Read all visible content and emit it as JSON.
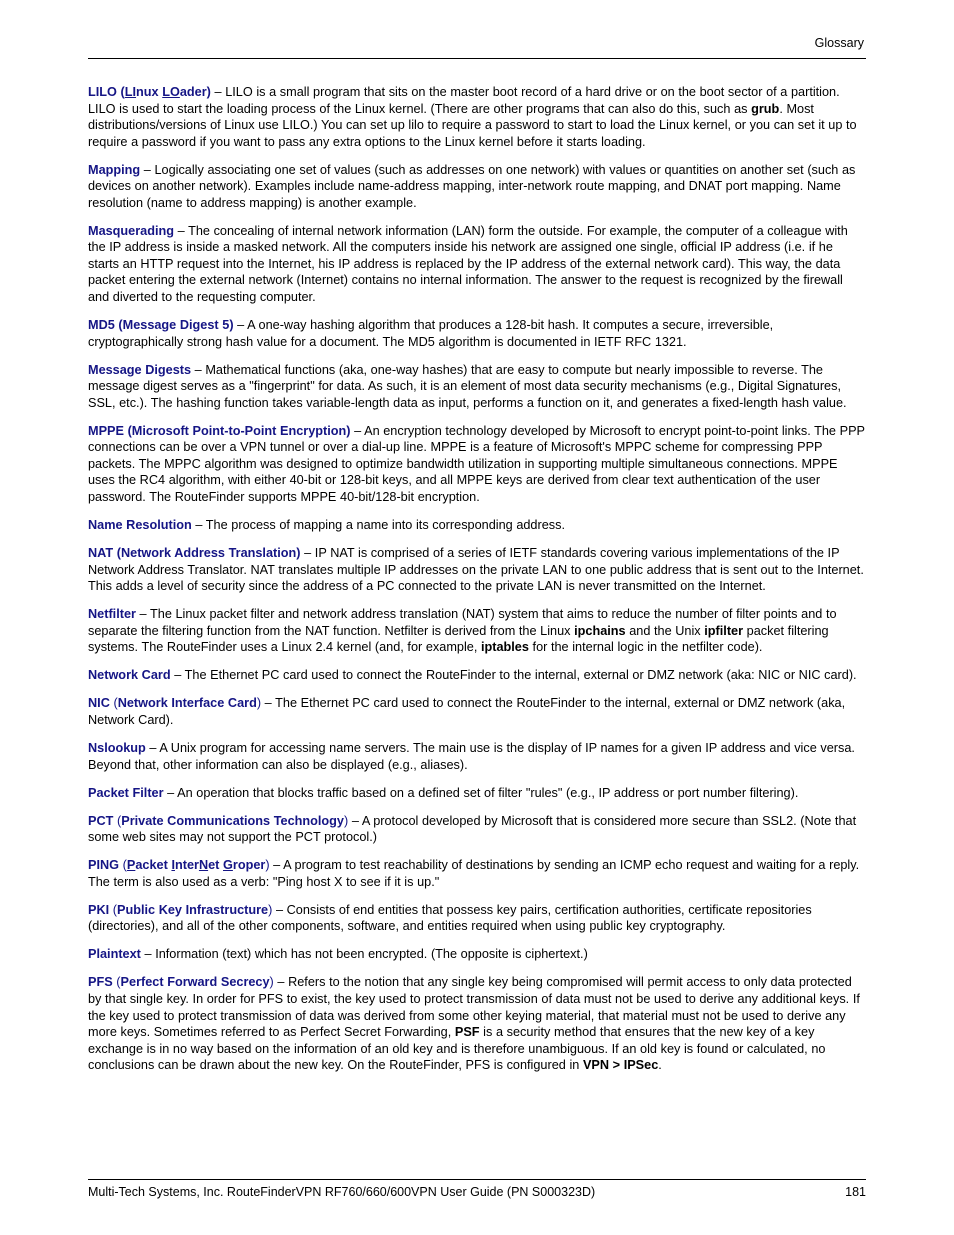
{
  "header": {
    "title": "Glossary"
  },
  "footer": {
    "source": "Multi-Tech Systems, Inc. RouteFinderVPN RF760/660/600VPN User Guide (PN S000323D)",
    "page_number": "181"
  },
  "colors": {
    "term": "#151585",
    "body": "#000000",
    "rule": "#000000",
    "background": "#ffffff"
  },
  "entries": [
    {
      "id": "lilo",
      "term": "LILO",
      "expansion_prefix": " (",
      "expansion_parts": [
        {
          "text": "LI",
          "underline": true
        },
        {
          "text": "nux ",
          "underline": false
        },
        {
          "text": "LO",
          "underline": true
        },
        {
          "text": "ader",
          "underline": false
        }
      ],
      "expansion_suffix": ")",
      "body": " – LILO is a small program that sits on the master boot record of a hard drive or on the boot sector of a partition. LILO is used to start the loading process of the Linux kernel.  (There are other programs that can also do this, such as ",
      "body_bold": "grub",
      "body_tail": ".  Most distributions/versions of Linux use LILO.)  You can set up lilo to require a password to start to load the Linux kernel, or you can set it up to require a password if you want to pass any extra options to the Linux kernel before it starts loading."
    },
    {
      "id": "mapping",
      "term": "Mapping",
      "body": " – Logically associating one set of values (such as addresses on one network) with values or quantities on another set (such as devices on another network).  Examples include name-address mapping, inter-network route mapping, and DNAT port mapping.  Name resolution (name to address mapping) is another example."
    },
    {
      "id": "masquerading",
      "term": "Masquerading",
      "body": " – The concealing of internal network information (LAN) form the outside. For example, the computer of a colleague with the IP address is inside a masked network. All the computers inside his network are assigned one single, official IP address (i.e. if he starts an HTTP request into the Internet, his IP address is replaced by the IP address of the external network card). This way, the data packet entering the external network (Internet) contains no internal information. The answer to the request is recognized by the firewall and diverted to the requesting computer."
    },
    {
      "id": "md5",
      "term": "MD5 (Message Digest 5)",
      "body": " – A one-way hashing algorithm that produces a 128-bit hash. It computes a secure, irreversible, cryptographically strong hash value for a document. The MD5 algorithm is documented in IETF RFC 1321."
    },
    {
      "id": "message-digests",
      "term": "Message Digests",
      "body": " – Mathematical functions (aka, one-way hashes) that are easy to compute but nearly impossible to reverse. The message digest serves as a \"fingerprint\" for data. As such, it is an element of most data security mechanisms (e.g., Digital Signatures, SSL, etc.). The hashing function takes variable-length data as input, performs a function on it, and generates a fixed-length hash value."
    },
    {
      "id": "mppe",
      "term": "MPPE (Microsoft Point-to-Point Encryption)",
      "body": " – An encryption technology developed by Microsoft to encrypt point-to-point links.  The PPP connections can be over a VPN tunnel or over a dial-up line. MPPE is a feature of Microsoft's MPPC scheme for compressing PPP packets.  The MPPC algorithm was designed to optimize bandwidth utilization in supporting multiple simultaneous connections.  MPPE uses the RC4 algorithm, with either 40-bit or 128-bit keys, and all MPPE keys are derived from clear text authentication of the user password.  The RouteFinder supports MPPE 40-bit/128-bit encryption."
    },
    {
      "id": "name-resolution",
      "term": "Name Resolution",
      "body": " – The process of mapping a name into its corresponding address."
    },
    {
      "id": "nat",
      "term": "NAT (Network Address Translation)",
      "body": " – IP NAT is comprised of a series of IETF standards covering various implementations of the IP Network Address Translator.  NAT translates multiple IP addresses on the private LAN to one public address that is sent out to the Internet. This adds a level of security since the address of a PC connected to the private LAN is never transmitted on the Internet."
    },
    {
      "id": "netfilter",
      "term": "Netfilter",
      "body": " – The Linux packet filter and network address translation (NAT) system that aims to reduce the number of filter points and to separate the filtering function from the NAT function. Netfilter is derived from the Linux ",
      "body_bold": "ipchains",
      "body_mid": " and the Unix ",
      "body_bold2": "ipfilter",
      "body_mid2": " packet filtering systems. The RouteFinder uses a Linux 2.4 kernel (and, for example, ",
      "body_bold3": "iptables",
      "body_tail": " for the internal logic in the netfilter code)."
    },
    {
      "id": "network-card",
      "term": "Network Card",
      "body": " – The Ethernet PC card used to connect the RouteFinder to the internal, external or DMZ network (aka: NIC or NIC card)."
    },
    {
      "id": "nic",
      "term": "NIC",
      "paren_open": " (",
      "term2": "Network Interface Card",
      "paren_close": ")",
      "body": " – The Ethernet PC card used to connect the RouteFinder to the internal, external or DMZ network (aka, Network Card)."
    },
    {
      "id": "nslookup",
      "term": "Nslookup",
      "body": " – A Unix program for accessing name servers. The main use is the display of IP names for a given IP address and vice versa. Beyond that, other information can also be displayed (e.g., aliases)."
    },
    {
      "id": "packet-filter",
      "term": "Packet Filter",
      "body": " – An operation that blocks traffic based on a defined set of filter \"rules\" (e.g., IP address or port number filtering)."
    },
    {
      "id": "pct",
      "term": "PCT",
      "paren_open": " (",
      "term2": "Private Communications Technology",
      "paren_close": ")",
      "body": " – A protocol developed by Microsoft that is considered more secure than SSL2. (Note that some web sites may not support the PCT protocol.)"
    },
    {
      "id": "ping",
      "term": "PING",
      "expansion_prefix": " (",
      "expansion_parts": [
        {
          "text": "P",
          "underline": true
        },
        {
          "text": "acket ",
          "underline": false
        },
        {
          "text": "I",
          "underline": true
        },
        {
          "text": "nter",
          "underline": false
        },
        {
          "text": "N",
          "underline": true
        },
        {
          "text": "et ",
          "underline": false
        },
        {
          "text": "G",
          "underline": true
        },
        {
          "text": "roper",
          "underline": false
        }
      ],
      "expansion_suffix": ")",
      "body": " – A program to test reachability of destinations by sending an ICMP echo request and waiting for a reply.  The term is also used as a verb: \"Ping host X to see if it is up.\""
    },
    {
      "id": "pki",
      "term": "PKI",
      "paren_open": " (",
      "term2": "Public Key Infrastructure",
      "paren_close": ")",
      "body": " – Consists of end entities that possess key pairs, certification authorities, certificate repositories (directories), and all of the other components, software, and entities required when using public key cryptography."
    },
    {
      "id": "plaintext",
      "term": "Plaintext",
      "body": " – Information (text) which has not been encrypted. (The opposite is ciphertext.)"
    },
    {
      "id": "pfs",
      "term": "PFS",
      "paren_open": " (",
      "term2": "Perfect Forward Secrecy",
      "paren_close": ")",
      "body": " – Refers to the notion that any single key being compromised will permit access to only data protected by that single key. In order for PFS to exist, the key used to protect transmission of data must not be used to derive any additional keys. If the key used to protect transmission of data was derived from some other keying material, that material must not be used to derive any more keys. Sometimes referred to as Perfect Secret Forwarding, ",
      "body_bold": "PSF",
      "body_mid": " is a security method that ensures that the new key of a key exchange is in no way based on the information of an old key and is therefore unambiguous. If an old key is found or calculated, no conclusions can be drawn about the new key. On the RouteFinder, PFS is configured in ",
      "body_bold2": "VPN > IPSec",
      "body_tail": "."
    }
  ]
}
